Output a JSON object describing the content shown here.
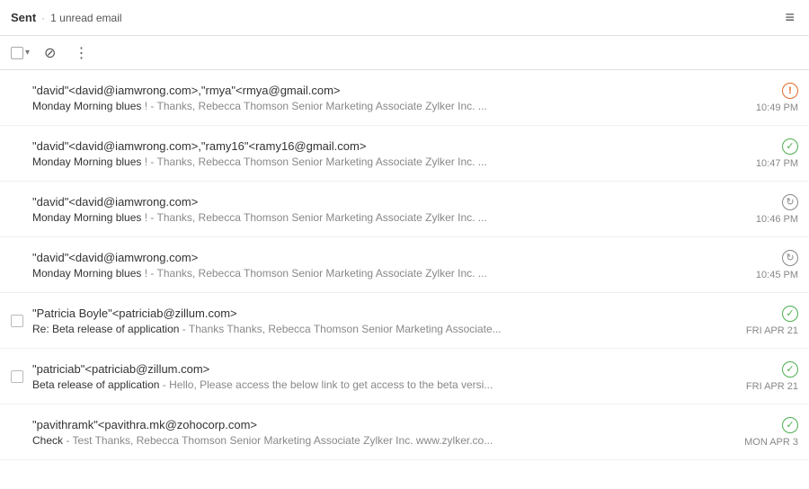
{
  "header": {
    "folder_label": "Sent",
    "dot_separator": "·",
    "unread_text": "1 unread email",
    "hamburger_icon": "≡"
  },
  "toolbar": {
    "filter_icon": "⊘",
    "more_icon": "⋮",
    "chevron": "▾"
  },
  "emails": [
    {
      "id": 1,
      "recipients": "\"david\"<david@iamwrong.com>,\"rmya\"<rmya@gmail.com>",
      "subject": "Monday Morning blues",
      "preview": " ! - Thanks, Rebecca Thomson Senior Marketing Associate Zylker Inc. ...",
      "status": "error",
      "time": "10:49 PM",
      "has_checkbox": false
    },
    {
      "id": 2,
      "recipients": "\"david\"<david@iamwrong.com>,\"ramy16\"<ramy16@gmail.com>",
      "subject": "Monday Morning blues",
      "preview": " ! - Thanks, Rebecca Thomson Senior Marketing Associate Zylker Inc. ...",
      "status": "sent",
      "time": "10:47 PM",
      "has_checkbox": false
    },
    {
      "id": 3,
      "recipients": "\"david\"<david@iamwrong.com>",
      "subject": "Monday Morning blues",
      "preview": " ! - Thanks, Rebecca Thomson Senior Marketing Associate Zylker Inc. ...",
      "status": "pending",
      "time": "10:46 PM",
      "has_checkbox": false
    },
    {
      "id": 4,
      "recipients": "\"david\"<david@iamwrong.com>",
      "subject": "Monday Morning blues",
      "preview": " ! - Thanks, Rebecca Thomson Senior Marketing Associate Zylker Inc. ...",
      "status": "pending",
      "time": "10:45 PM",
      "has_checkbox": false
    },
    {
      "id": 5,
      "recipients": "\"Patricia Boyle\"<patriciab@zillum.com>",
      "subject": "Re: Beta release of application",
      "preview": " - Thanks Thanks, Rebecca Thomson Senior Marketing Associate...",
      "status": "sent",
      "time": "FRI APR 21",
      "has_checkbox": true
    },
    {
      "id": 6,
      "recipients": "\"patriciab\"<patriciab@zillum.com>",
      "subject": "Beta release of application",
      "preview": " - Hello, Please access the below link to get access to the beta versi...",
      "status": "sent",
      "time": "FRI APR 21",
      "has_checkbox": true
    },
    {
      "id": 7,
      "recipients": "\"pavithramk\"<pavithra.mk@zohocorp.com>",
      "subject": "Check",
      "preview": " - Test Thanks, Rebecca Thomson Senior Marketing Associate Zylker Inc. www.zylker.co...",
      "status": "sent",
      "time": "MON APR 3",
      "has_checkbox": false
    }
  ]
}
